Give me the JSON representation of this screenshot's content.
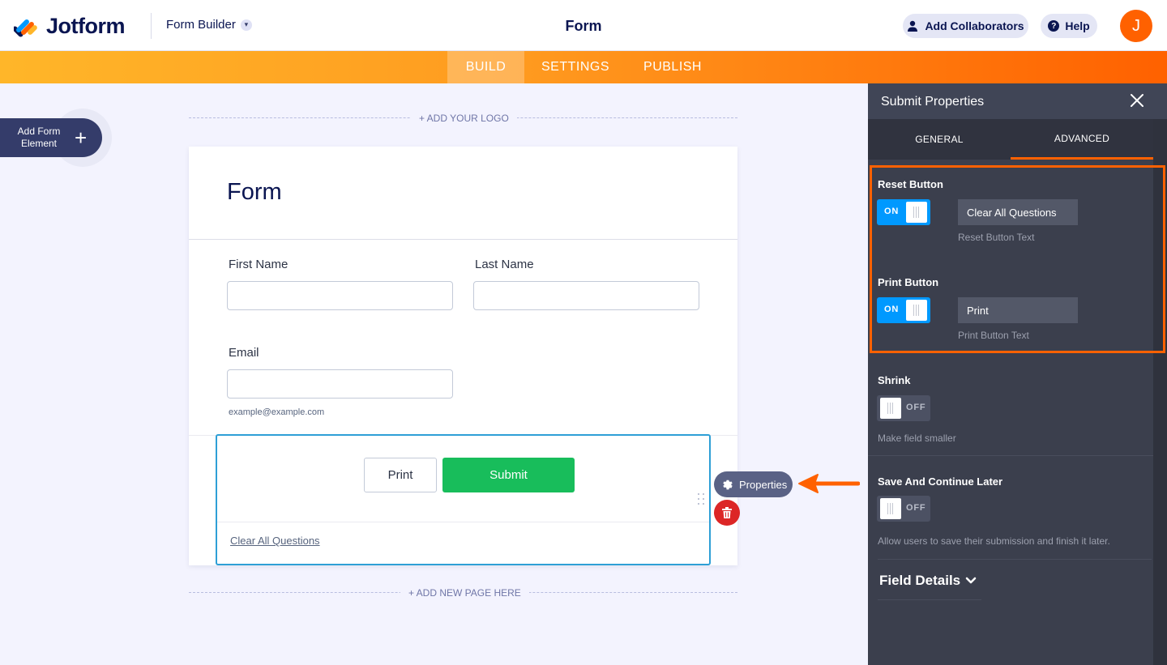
{
  "header": {
    "brand": "Jotform",
    "menu_label": "Form Builder",
    "form_title": "Form",
    "collaborators_label": "Add Collaborators",
    "help_label": "Help",
    "avatar_initial": "J"
  },
  "nav": {
    "tabs": [
      {
        "label": "BUILD",
        "active": true
      },
      {
        "label": "SETTINGS",
        "active": false
      },
      {
        "label": "PUBLISH",
        "active": false
      }
    ]
  },
  "builder": {
    "add_element_label": "Add Form Element",
    "add_logo": "+ ADD YOUR LOGO",
    "add_page": "+ ADD NEW PAGE HERE"
  },
  "form": {
    "title": "Form",
    "first_name_label": "First Name",
    "last_name_label": "Last Name",
    "email_label": "Email",
    "email_sublabel": "example@example.com",
    "print_button": "Print",
    "submit_button": "Submit",
    "clear_link": "Clear All Questions",
    "properties_label": "Properties"
  },
  "panel": {
    "title": "Submit Properties",
    "tabs": [
      {
        "label": "GENERAL",
        "active": false
      },
      {
        "label": "ADVANCED",
        "active": true
      }
    ],
    "reset": {
      "title": "Reset Button",
      "state": "ON",
      "value": "Clear All Questions",
      "hint": "Reset Button Text"
    },
    "print": {
      "title": "Print Button",
      "state": "ON",
      "value": "Print",
      "hint": "Print Button Text"
    },
    "shrink": {
      "title": "Shrink",
      "state": "OFF",
      "hint": "Make field smaller"
    },
    "save_continue": {
      "title": "Save And Continue Later",
      "state": "OFF",
      "hint": "Allow users to save their submission and finish it later."
    },
    "field_details": "Field Details"
  },
  "colors": {
    "accent": "#ff6100",
    "toggle_on": "#0099ff",
    "submit": "#18bd5b",
    "selection": "#2e9fd6",
    "delete": "#dc2626"
  }
}
